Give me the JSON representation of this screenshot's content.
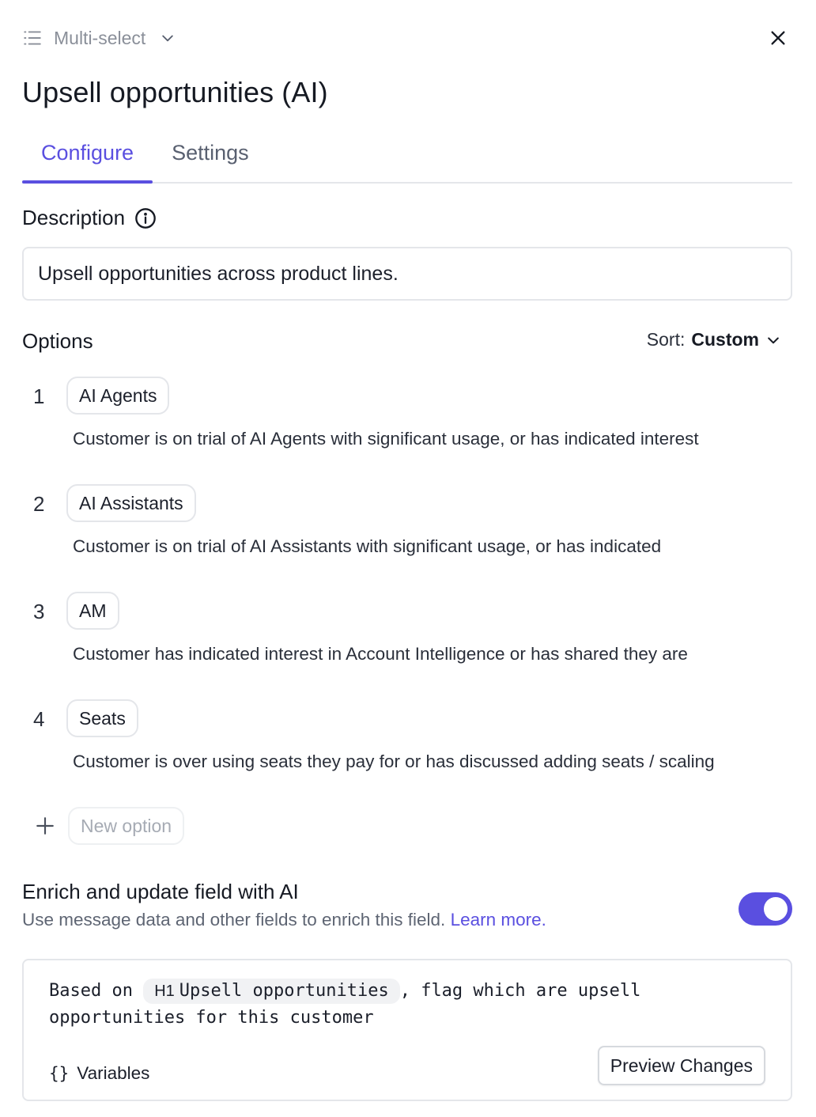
{
  "header": {
    "field_type": "Multi-select",
    "title": "Upsell opportunities (AI)"
  },
  "tabs": [
    {
      "label": "Configure",
      "active": true
    },
    {
      "label": "Settings",
      "active": false
    }
  ],
  "description": {
    "label": "Description",
    "value": "Upsell opportunities across product lines."
  },
  "options": {
    "label": "Options",
    "sort_label": "Sort:",
    "sort_value": "Custom",
    "items": [
      {
        "number": "1",
        "name": "AI Agents",
        "description": "Customer is on trial of AI Agents with significant usage, or has indicated interest"
      },
      {
        "number": "2",
        "name": "AI Assistants",
        "description": "Customer is on trial of AI Assistants with significant usage, or has indicated"
      },
      {
        "number": "3",
        "name": "AM",
        "description": "Customer has indicated interest in Account Intelligence or has shared they are"
      },
      {
        "number": "4",
        "name": "Seats",
        "description": "Customer is over using seats they pay for or has discussed adding seats / scaling"
      }
    ],
    "new_option_placeholder": "New option"
  },
  "enrich": {
    "title": "Enrich and update field with AI",
    "subtitle": "Use message data and other fields to enrich this field.",
    "learn_more": "Learn more.",
    "enabled": true,
    "prompt_before": "Based on ",
    "prompt_variable_badge": "H1",
    "prompt_variable": "Upsell opportunities",
    "prompt_after": ", flag which are upsell opportunities for this customer",
    "variables_label": "Variables",
    "variables_icon": "{}",
    "preview_label": "Preview Changes"
  },
  "colors": {
    "accent": "#5a4fe0",
    "border": "#e4e6ea",
    "muted_text": "#8a8f99"
  }
}
